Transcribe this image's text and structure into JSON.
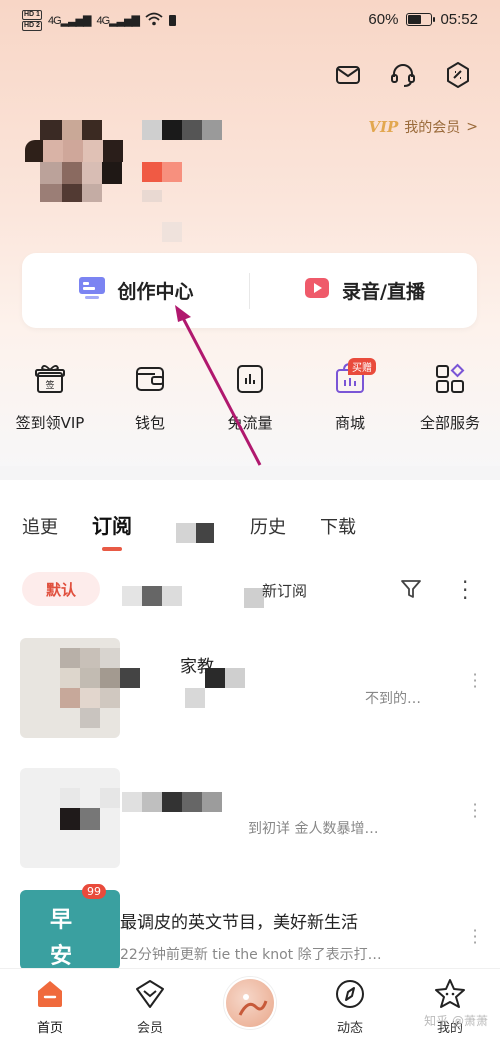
{
  "status_bar": {
    "hd1": "HD 1",
    "hd2": "HD 2",
    "signal1": "4G",
    "signal2": "4G",
    "battery_text": "60%",
    "time": "05:52",
    "battery_level": 0.6
  },
  "header": {
    "vip_badge": "VIP",
    "vip_label": "我的会员",
    "vip_chevron": ">"
  },
  "create_card": {
    "creation_center": "创作中心",
    "record_live": "录音/直播"
  },
  "services": [
    {
      "label": "签到领VIP",
      "icon": "gift-sign-icon"
    },
    {
      "label": "钱包",
      "icon": "wallet-icon"
    },
    {
      "label": "免流量",
      "icon": "data-free-icon"
    },
    {
      "label": "商城",
      "icon": "store-icon",
      "badge": "买赠"
    },
    {
      "label": "全部服务",
      "icon": "all-services-icon"
    }
  ],
  "tabs": [
    "追更",
    "订阅",
    "",
    "历史",
    "下载"
  ],
  "active_tab": "订阅",
  "filter": {
    "default_chip": "默认",
    "sub_label": "新订阅"
  },
  "list": [
    {
      "title": "家教",
      "subtitle": "不到的…"
    },
    {
      "title": "",
      "subtitle": "到初详   金人数暴增…"
    },
    {
      "title": "最调皮的英文节目，美好新生活",
      "subtitle": "22分钟前更新  tie the knot 除了表示打…",
      "badge": "99",
      "thumb_text_1": "早",
      "thumb_text_2": "安"
    }
  ],
  "bottom_nav": [
    {
      "label": "首页",
      "icon": "home-icon"
    },
    {
      "label": "会员",
      "icon": "member-icon"
    },
    {
      "label": "",
      "icon": "play-center-icon"
    },
    {
      "label": "动态",
      "icon": "dynamic-icon"
    },
    {
      "label": "我的",
      "icon": "profile-star-icon"
    }
  ],
  "watermark": "知乎 @萧萧",
  "colors": {
    "accent": "#e85a45",
    "vip_gold": "#e2a74f",
    "annotation": "#b0186e"
  }
}
